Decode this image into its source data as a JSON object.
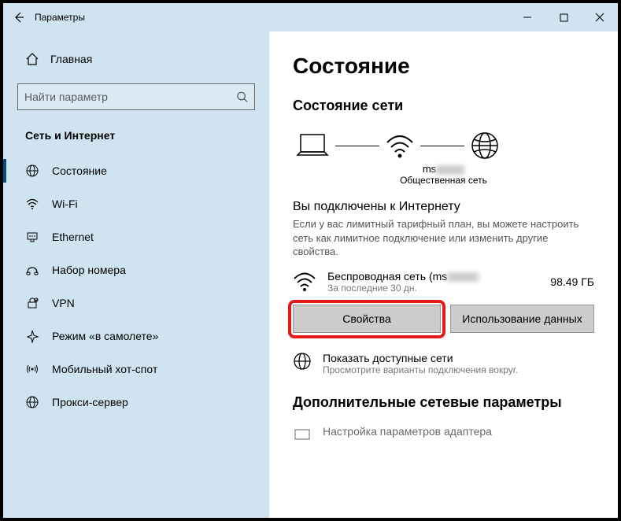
{
  "window": {
    "title": "Параметры"
  },
  "sidebar": {
    "home": "Главная",
    "search_placeholder": "Найти параметр",
    "section": "Сеть и Интернет",
    "items": [
      {
        "label": "Состояние"
      },
      {
        "label": "Wi-Fi"
      },
      {
        "label": "Ethernet"
      },
      {
        "label": "Набор номера"
      },
      {
        "label": "VPN"
      },
      {
        "label": "Режим «в самолете»"
      },
      {
        "label": "Мобильный хот-спот"
      },
      {
        "label": "Прокси-сервер"
      }
    ]
  },
  "main": {
    "title": "Состояние",
    "net_status_title": "Состояние сети",
    "ssid_prefix": "ms",
    "net_type": "Общественная сеть",
    "connected_title": "Вы подключены к Интернету",
    "connected_desc": "Если у вас лимитный тарифный план, вы можете настроить сеть как лимитное подключение или изменить другие свойства.",
    "conn_name_prefix": "Беспроводная сеть (ms",
    "conn_sub": "За последние 30 дн.",
    "conn_size": "98.49 ГБ",
    "btn_properties": "Свойства",
    "btn_usage": "Использование данных",
    "show_nets": "Показать доступные сети",
    "show_nets_sub": "Просмотрите варианты подключения вокруг.",
    "adv_title": "Дополнительные сетевые параметры",
    "adapter": "Настройка параметров адаптера"
  }
}
